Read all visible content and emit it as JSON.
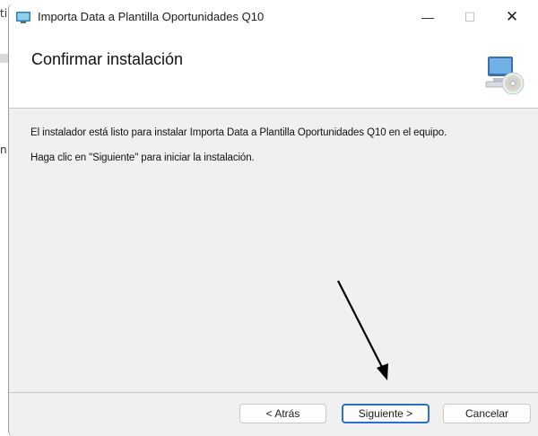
{
  "window": {
    "title": "Importa Data a Plantilla Oportunidades Q10",
    "controls": {
      "minimize": "—",
      "maximize": "☐",
      "close": "✕"
    }
  },
  "header": {
    "title": "Confirmar instalación",
    "icon": "computer-cd-icon"
  },
  "body": {
    "line1": "El instalador está listo para instalar Importa Data a Plantilla Oportunidades Q10 en el equipo.",
    "line2": "Haga clic en \"Siguiente\" para iniciar la instalación."
  },
  "buttons": {
    "back": "< Atrás",
    "next": "Siguiente >",
    "cancel": "Cancelar"
  },
  "background": {
    "fragment_top": "ti",
    "fragment_mid": "n"
  },
  "colors": {
    "accent": "#2a6fc9",
    "arrow": "#000000"
  }
}
